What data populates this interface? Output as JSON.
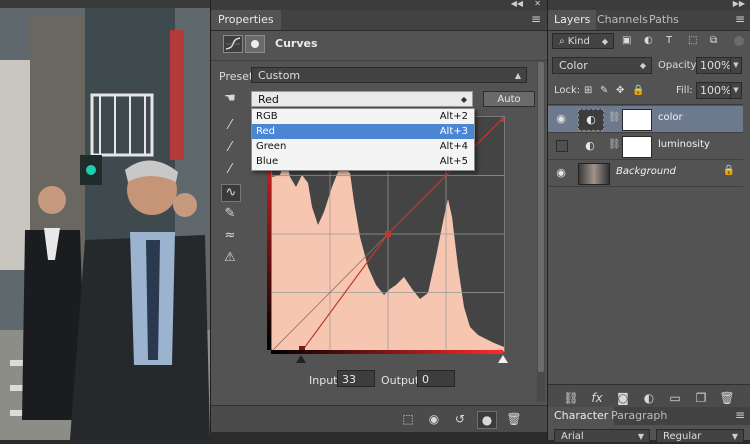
{
  "properties": {
    "tab_label": "Properties",
    "panel_title": "Curves",
    "preset_label": "Preset:",
    "preset_value": "Custom",
    "channel_value": "Red",
    "auto_label": "Auto",
    "channel_options": [
      {
        "label": "RGB",
        "shortcut": "Alt+2"
      },
      {
        "label": "Red",
        "shortcut": "Alt+3"
      },
      {
        "label": "Green",
        "shortcut": "Alt+4"
      },
      {
        "label": "Blue",
        "shortcut": "Alt+5"
      }
    ],
    "input_label": "Input:",
    "input_value": "33",
    "output_label": "Output:",
    "output_value": "0"
  },
  "layers": {
    "tabs": [
      "Layers",
      "Channels",
      "Paths"
    ],
    "kind_label": "Kind",
    "blend_mode": "Color",
    "opacity_label": "Opacity:",
    "opacity_value": "100%",
    "lock_label": "Lock:",
    "fill_label": "Fill:",
    "fill_value": "100%",
    "items": [
      {
        "name": "color"
      },
      {
        "name": "luminosity"
      },
      {
        "name": "Background"
      }
    ]
  },
  "character": {
    "tabs": [
      "Character",
      "Paragraph"
    ],
    "font_family": "Arial",
    "font_style": "Regular"
  },
  "colors": {
    "panel_bg": "#535353",
    "histogram_fill": "#f7c6b1",
    "selected_layer": "#6d7a8e",
    "highlight": "#4a86d4"
  }
}
